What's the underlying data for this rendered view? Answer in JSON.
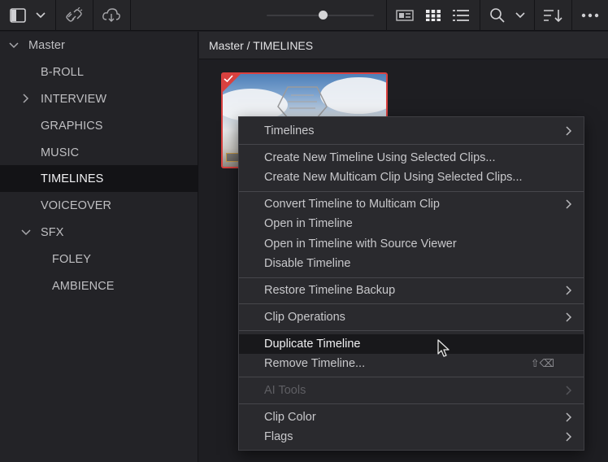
{
  "toolbar": {
    "icons": [
      "sidebar-toggle-icon",
      "chevron-down-icon",
      "unlink-icon",
      "cloud-sync-icon",
      "metadata-view-icon",
      "thumbnail-view-icon",
      "list-view-icon",
      "search-icon",
      "chevron-down-icon",
      "sort-icon",
      "more-icon"
    ],
    "zoom_level": 0.53
  },
  "sidebar": {
    "items": [
      {
        "label": "Master",
        "expanded": true
      },
      {
        "label": "B-ROLL"
      },
      {
        "label": "INTERVIEW",
        "expandable": true
      },
      {
        "label": "GRAPHICS"
      },
      {
        "label": "MUSIC"
      },
      {
        "label": "TIMELINES",
        "selected": true
      },
      {
        "label": "VOICEOVER"
      },
      {
        "label": "SFX",
        "expanded": true
      },
      {
        "label": "FOLEY"
      },
      {
        "label": "AMBIENCE"
      }
    ]
  },
  "breadcrumb": "Master / TIMELINES",
  "context_menu": {
    "items": [
      {
        "label": "Timelines",
        "submenu": true
      },
      {
        "label": "Create New Timeline Using Selected Clips..."
      },
      {
        "label": "Create New Multicam Clip Using Selected Clips..."
      },
      {
        "label": "Convert Timeline to Multicam Clip",
        "submenu": true
      },
      {
        "label": "Open in Timeline"
      },
      {
        "label": "Open in Timeline with Source Viewer"
      },
      {
        "label": "Disable Timeline"
      },
      {
        "label": "Restore Timeline Backup",
        "submenu": true
      },
      {
        "label": "Clip Operations",
        "submenu": true
      },
      {
        "label": "Duplicate Timeline",
        "hovered": true
      },
      {
        "label": "Remove Timeline...",
        "shortcut": "⇧⌫"
      },
      {
        "label": "AI Tools",
        "submenu": true,
        "disabled": true
      },
      {
        "label": "Clip Color",
        "submenu": true
      },
      {
        "label": "Flags",
        "submenu": true
      }
    ]
  },
  "colors": {
    "accent_red": "#d9413f",
    "menu_bg": "#2a2a2e",
    "selected_bg": "#131316"
  }
}
